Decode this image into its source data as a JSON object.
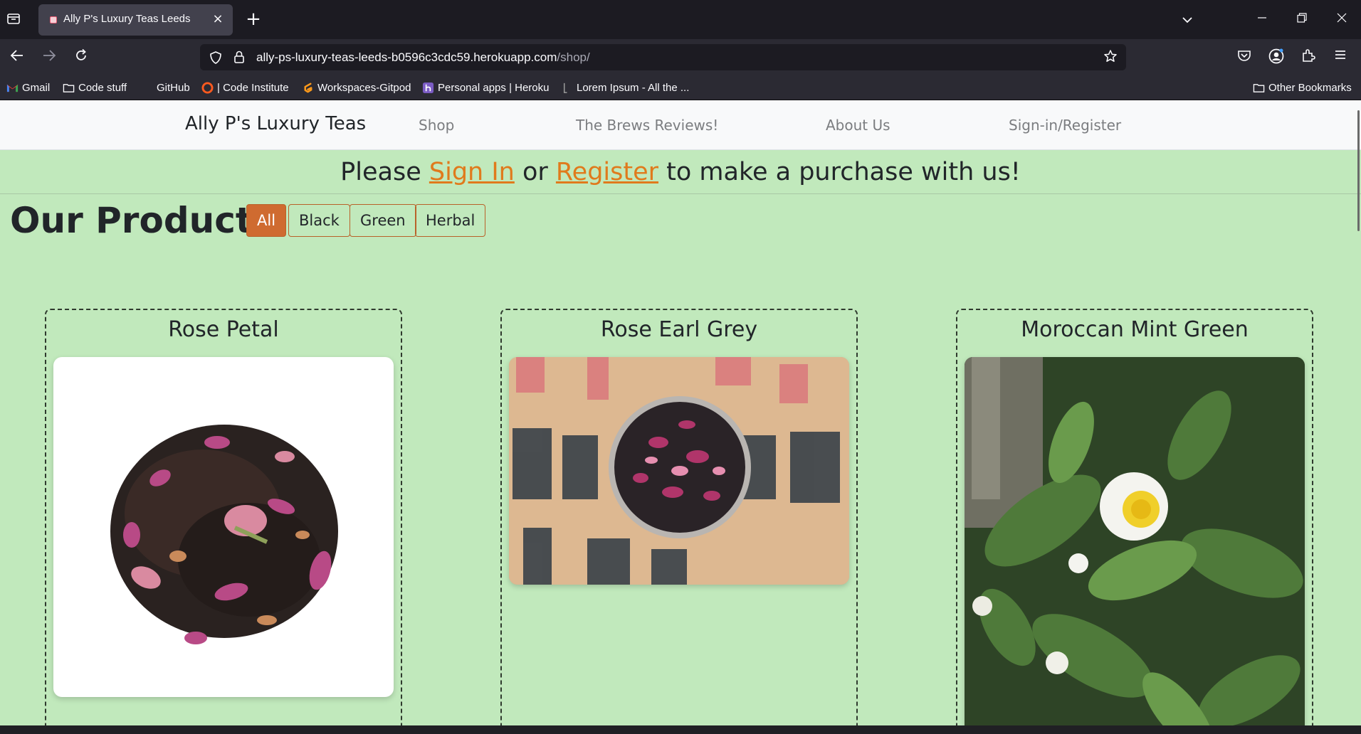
{
  "browser": {
    "tab_title": "Ally P's Luxury Teas Leeds",
    "url_host": "ally-ps-luxury-teas-leeds-b0596c3cdc59.herokuapp.com",
    "url_path": "/shop/",
    "bookmarks": [
      {
        "label": "Gmail",
        "icon": "gmail-icon"
      },
      {
        "label": "Code stuff",
        "icon": "folder-icon"
      },
      {
        "label": "GitHub",
        "icon": "github-icon"
      },
      {
        "label": "| Code Institute",
        "icon": "code-institute-icon"
      },
      {
        "label": "Workspaces-Gitpod",
        "icon": "gitpod-icon"
      },
      {
        "label": "Personal apps | Heroku",
        "icon": "heroku-icon"
      },
      {
        "label": "Lorem Ipsum - All the ...",
        "icon": "lorem-ipsum-icon"
      }
    ],
    "other_bookmarks": "Other Bookmarks"
  },
  "site": {
    "brand": "Ally P's Luxury Teas",
    "nav": [
      "Shop",
      "The Brews Reviews!",
      "About Us",
      "Sign-in/Register"
    ],
    "banner": {
      "before": "Please ",
      "sign_in": "Sign In",
      "middle": " or ",
      "register": "Register",
      "after": " to make a purchase with us!"
    },
    "products_heading": "Our Products:",
    "filters": [
      "All",
      "Black",
      "Green",
      "Herbal"
    ],
    "active_filter": "All",
    "products": [
      {
        "name": "Rose Petal"
      },
      {
        "name": "Rose Earl Grey"
      },
      {
        "name": "Moroccan Mint Green"
      }
    ]
  },
  "colors": {
    "page_bg": "#c1e9bc",
    "accent": "#cf6b30",
    "link": "#e07a1c"
  }
}
